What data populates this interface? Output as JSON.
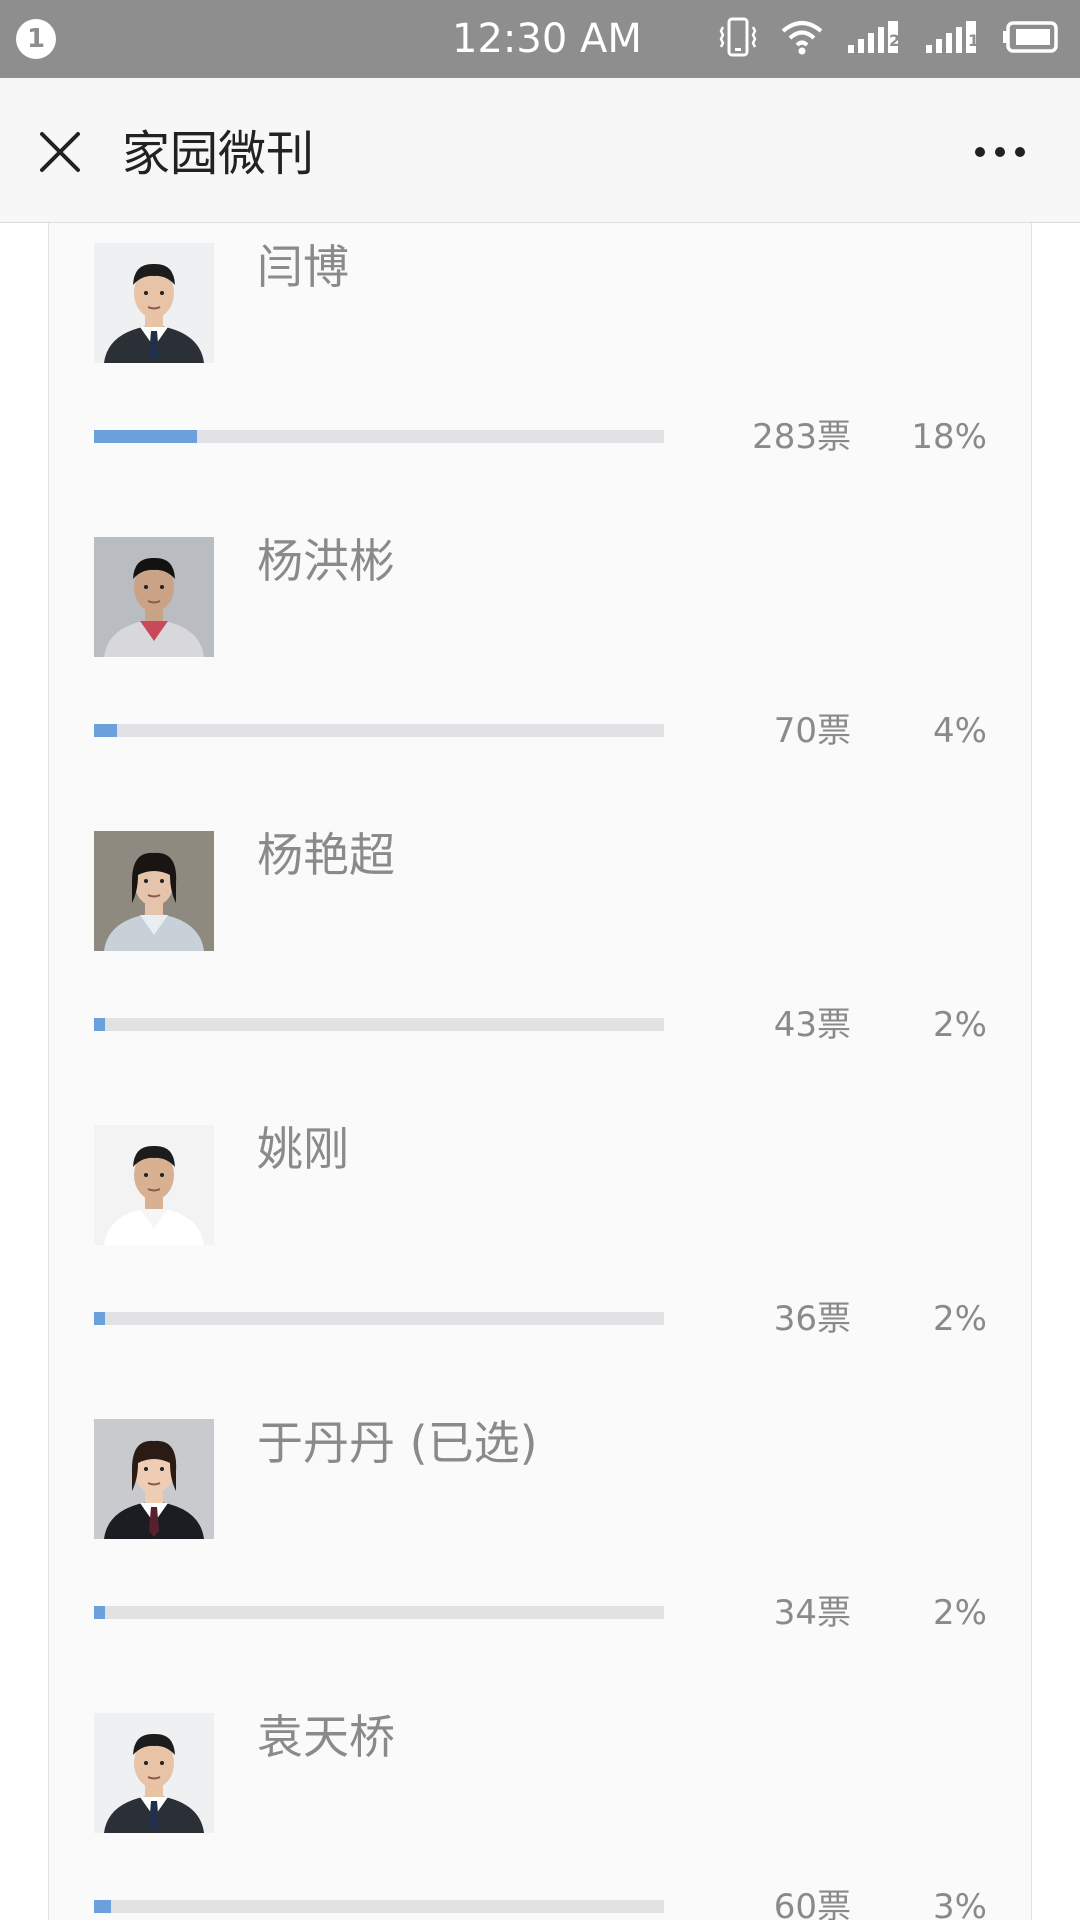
{
  "status_bar": {
    "notification_count": "1",
    "time": "12:30 AM",
    "sim1_label": "2",
    "sim2_label": "1",
    "icons": [
      "vibrate-icon",
      "wifi-icon",
      "signal-icon",
      "signal-icon",
      "battery-icon"
    ]
  },
  "app_bar": {
    "title": "家园微刊",
    "close_icon": "close-icon",
    "more_icon": "more-icon"
  },
  "colors": {
    "status_bar_bg": "#8e8e8e",
    "bar_fill": "#6aa0dc",
    "bar_track": "#e2e2e4",
    "text_muted": "#8a8a8a"
  },
  "candidates": [
    {
      "name": "闫博",
      "votes": "283票",
      "percent": "18%",
      "share": 0.18,
      "avatar_style": "suit"
    },
    {
      "name": "杨洪彬",
      "votes": "70票",
      "percent": "4%",
      "share": 0.04,
      "avatar_style": "casual"
    },
    {
      "name": "杨艳超",
      "votes": "43票",
      "percent": "2%",
      "share": 0.02,
      "avatar_style": "woman-casual"
    },
    {
      "name": "姚刚",
      "votes": "36票",
      "percent": "2%",
      "share": 0.02,
      "avatar_style": "white-shirt"
    },
    {
      "name": "于丹丹 (已选)",
      "votes": "34票",
      "percent": "2%",
      "share": 0.02,
      "avatar_style": "woman-suit"
    },
    {
      "name": "袁天桥",
      "votes": "60票",
      "percent": "3%",
      "share": 0.03,
      "avatar_style": "suit"
    }
  ]
}
